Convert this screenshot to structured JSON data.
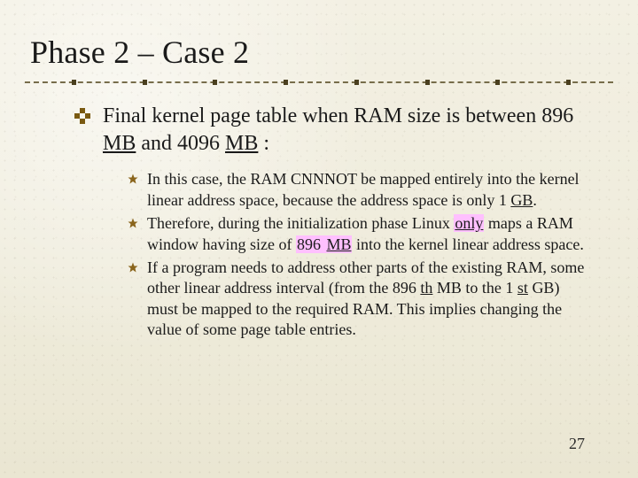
{
  "title": "Phase 2 – Case 2",
  "main": {
    "text_before": "Final kernel page table when RAM size is between 896 ",
    "mb1": "MB",
    "text_mid": " and 4096 ",
    "mb2": "MB",
    "text_after": " :"
  },
  "subs": [
    {
      "pre": "In this case, the RAM CNNNOT be mapped entirely into the kernel linear address space, because the address space is only 1 ",
      "gb": "GB",
      "post": "."
    },
    {
      "pre": "Therefore, during the initialization phase Linux ",
      "only": "only",
      "mid1": " maps a RAM window having size of ",
      "num": "896 ",
      "mb": "MB",
      "post": " into the kernel linear address space."
    },
    {
      "pre": "If a program needs to address other parts of the existing RAM, some other linear address interval (from the 896 ",
      "th1": "th",
      "mid1": " MB to the 1 ",
      "st": "st",
      "post": " GB) must be mapped to the required RAM. This implies changing the value of some page table entries."
    }
  ],
  "page_number": "27"
}
